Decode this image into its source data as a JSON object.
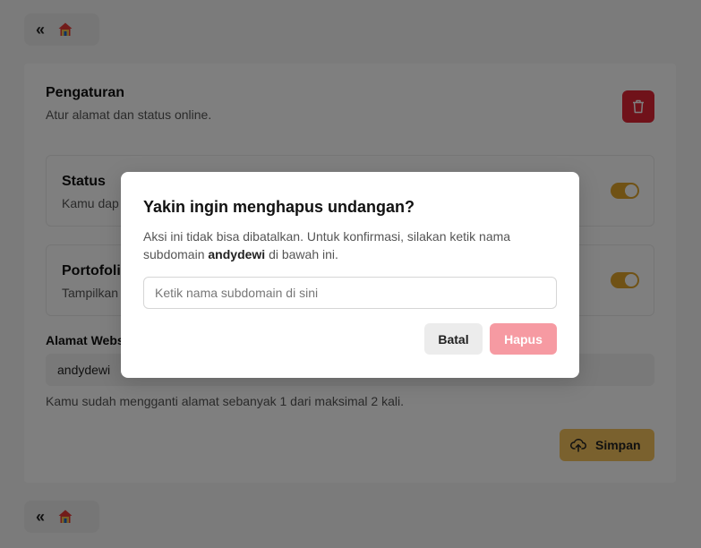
{
  "nav": {
    "back_glyph": "«",
    "home_icon": "home-icon"
  },
  "settings": {
    "title": "Pengaturan",
    "subtitle": "Atur alamat dan status online.",
    "rows": [
      {
        "title": "Status",
        "description": "Kamu dap",
        "toggle_on": true
      },
      {
        "title": "Portofoli",
        "description": "Tampilkan",
        "toggle_on": true
      }
    ],
    "address_label": "Alamat Webs",
    "address_value": "andydewi",
    "address_help": "Kamu sudah mengganti alamat sebanyak 1 dari maksimal 2 kali.",
    "save_label": "Simpan"
  },
  "modal": {
    "title": "Yakin ingin menghapus undangan?",
    "desc_pre": "Aksi ini tidak bisa dibatalkan. Untuk konfirmasi, silakan ketik nama subdomain ",
    "desc_bold": "andydewi",
    "desc_post": " di bawah ini.",
    "input_placeholder": "Ketik nama subdomain di sini",
    "cancel_label": "Batal",
    "delete_label": "Hapus"
  },
  "colors": {
    "accent": "#f4c25c",
    "danger": "#e02434",
    "danger_disabled": "#f69aa2",
    "toggle_on": "#e0a42a"
  }
}
